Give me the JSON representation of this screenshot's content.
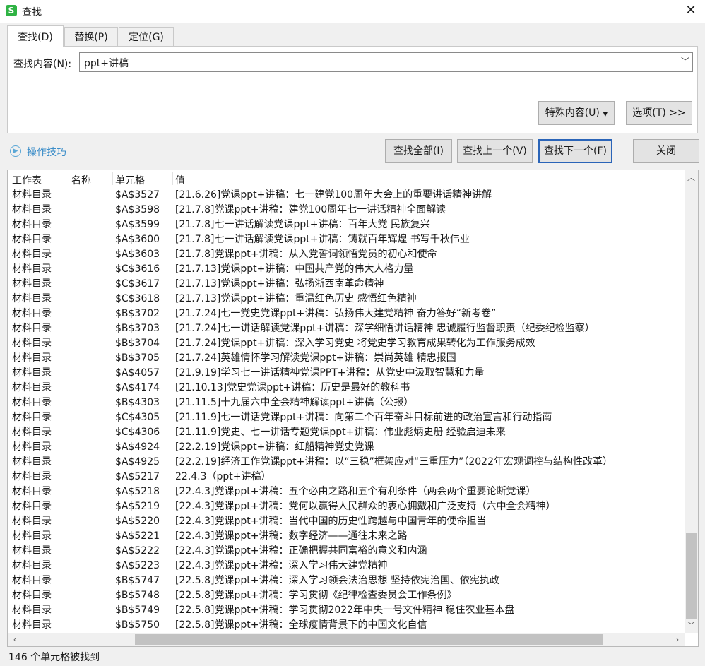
{
  "window": {
    "title": "查找",
    "app_icon_letter": "S"
  },
  "tabs": [
    {
      "label": "查找(D)"
    },
    {
      "label": "替换(P)"
    },
    {
      "label": "定位(G)"
    }
  ],
  "find": {
    "label": "查找内容(N):",
    "value": "ppt+讲稿"
  },
  "buttons": {
    "special": "特殊内容(U)",
    "options": "选项(T) >>",
    "find_all": "查找全部(I)",
    "find_prev": "查找上一个(V)",
    "find_next": "查找下一个(F)",
    "close": "关闭"
  },
  "tips": "操作技巧",
  "table": {
    "headers": [
      "工作表",
      "名称",
      "单元格",
      "值"
    ],
    "rows": [
      {
        "sheet": "材料目录",
        "name": "",
        "cell": "$A$3527",
        "value": "[21.6.26]党课ppt+讲稿：七一建党100周年大会上的重要讲话精神讲解"
      },
      {
        "sheet": "材料目录",
        "name": "",
        "cell": "$A$3598",
        "value": "[21.7.8]党课ppt+讲稿：建党100周年七一讲话精神全面解读"
      },
      {
        "sheet": "材料目录",
        "name": "",
        "cell": "$A$3599",
        "value": "[21.7.8]七一讲话解读党课ppt+讲稿：百年大党 民族复兴"
      },
      {
        "sheet": "材料目录",
        "name": "",
        "cell": "$A$3600",
        "value": "[21.7.8]七一讲话解读党课ppt+讲稿：铸就百年辉煌 书写千秋伟业"
      },
      {
        "sheet": "材料目录",
        "name": "",
        "cell": "$A$3603",
        "value": "[21.7.8]党课ppt+讲稿：从入党誓词领悟党员的初心和使命"
      },
      {
        "sheet": "材料目录",
        "name": "",
        "cell": "$C$3616",
        "value": "[21.7.13]党课ppt+讲稿：中国共产党的伟大人格力量"
      },
      {
        "sheet": "材料目录",
        "name": "",
        "cell": "$C$3617",
        "value": "[21.7.13]党课ppt+讲稿：弘扬浙西南革命精神"
      },
      {
        "sheet": "材料目录",
        "name": "",
        "cell": "$C$3618",
        "value": "[21.7.13]党课ppt+讲稿：重温红色历史 感悟红色精神"
      },
      {
        "sheet": "材料目录",
        "name": "",
        "cell": "$B$3702",
        "value": "[21.7.24]七一党史党课ppt+讲稿：弘扬伟大建党精神 奋力答好“新考卷”"
      },
      {
        "sheet": "材料目录",
        "name": "",
        "cell": "$B$3703",
        "value": "[21.7.24]七一讲话解读党课ppt+讲稿：深学细悟讲话精神 忠诚履行监督职责（纪委纪检监察）"
      },
      {
        "sheet": "材料目录",
        "name": "",
        "cell": "$B$3704",
        "value": "[21.7.24]党课ppt+讲稿：深入学习党史 将党史学习教育成果转化为工作服务成效"
      },
      {
        "sheet": "材料目录",
        "name": "",
        "cell": "$B$3705",
        "value": "[21.7.24]英雄情怀学习解读党课ppt+讲稿：崇尚英雄 精忠报国"
      },
      {
        "sheet": "材料目录",
        "name": "",
        "cell": "$A$4057",
        "value": "[21.9.19]学习七一讲话精神党课PPT+讲稿：从党史中汲取智慧和力量"
      },
      {
        "sheet": "材料目录",
        "name": "",
        "cell": "$A$4174",
        "value": "[21.10.13]党史党课ppt+讲稿：历史是最好的教科书"
      },
      {
        "sheet": "材料目录",
        "name": "",
        "cell": "$B$4303",
        "value": "[21.11.5]十九届六中全会精神解读ppt+讲稿（公报）"
      },
      {
        "sheet": "材料目录",
        "name": "",
        "cell": "$C$4305",
        "value": "[21.11.9]七一讲话党课ppt+讲稿：向第二个百年奋斗目标前进的政治宣言和行动指南"
      },
      {
        "sheet": "材料目录",
        "name": "",
        "cell": "$C$4306",
        "value": "[21.11.9]党史、七一讲话专题党课ppt+讲稿：伟业彪炳史册  经验启迪未来"
      },
      {
        "sheet": "材料目录",
        "name": "",
        "cell": "$A$4924",
        "value": "[22.2.19]党课ppt+讲稿：红船精神党史党课"
      },
      {
        "sheet": "材料目录",
        "name": "",
        "cell": "$A$4925",
        "value": "[22.2.19]经济工作党课ppt+讲稿：以“三稳”框架应对“三重压力”（2022年宏观调控与结构性改革）"
      },
      {
        "sheet": "材料目录",
        "name": "",
        "cell": "$A$5217",
        "value": "22.4.3（ppt+讲稿）"
      },
      {
        "sheet": "材料目录",
        "name": "",
        "cell": "$A$5218",
        "value": "[22.4.3]党课ppt+讲稿：五个必由之路和五个有利条件（两会两个重要论断党课）"
      },
      {
        "sheet": "材料目录",
        "name": "",
        "cell": "$A$5219",
        "value": "[22.4.3]党课ppt+讲稿：党何以赢得人民群众的衷心拥戴和广泛支持（六中全会精神）"
      },
      {
        "sheet": "材料目录",
        "name": "",
        "cell": "$A$5220",
        "value": "[22.4.3]党课ppt+讲稿：当代中国的历史性跨越与中国青年的使命担当"
      },
      {
        "sheet": "材料目录",
        "name": "",
        "cell": "$A$5221",
        "value": "[22.4.3]党课ppt+讲稿：数字经济——通往未来之路"
      },
      {
        "sheet": "材料目录",
        "name": "",
        "cell": "$A$5222",
        "value": "[22.4.3]党课ppt+讲稿：正确把握共同富裕的意义和内涵"
      },
      {
        "sheet": "材料目录",
        "name": "",
        "cell": "$A$5223",
        "value": "[22.4.3]党课ppt+讲稿：深入学习伟大建党精神"
      },
      {
        "sheet": "材料目录",
        "name": "",
        "cell": "$B$5747",
        "value": "[22.5.8]党课ppt+讲稿：深入学习领会法治思想 坚持依宪治国、依宪执政"
      },
      {
        "sheet": "材料目录",
        "name": "",
        "cell": "$B$5748",
        "value": "[22.5.8]党课ppt+讲稿：学习贯彻《纪律检查委员会工作条例》"
      },
      {
        "sheet": "材料目录",
        "name": "",
        "cell": "$B$5749",
        "value": "[22.5.8]党课ppt+讲稿：学习贯彻2022年中央一号文件精神 稳住农业基本盘"
      },
      {
        "sheet": "材料目录",
        "name": "",
        "cell": "$B$5750",
        "value": "[22.5.8]党课ppt+讲稿：全球疫情背景下的中国文化自信"
      }
    ]
  },
  "status": "146 个单元格被找到"
}
